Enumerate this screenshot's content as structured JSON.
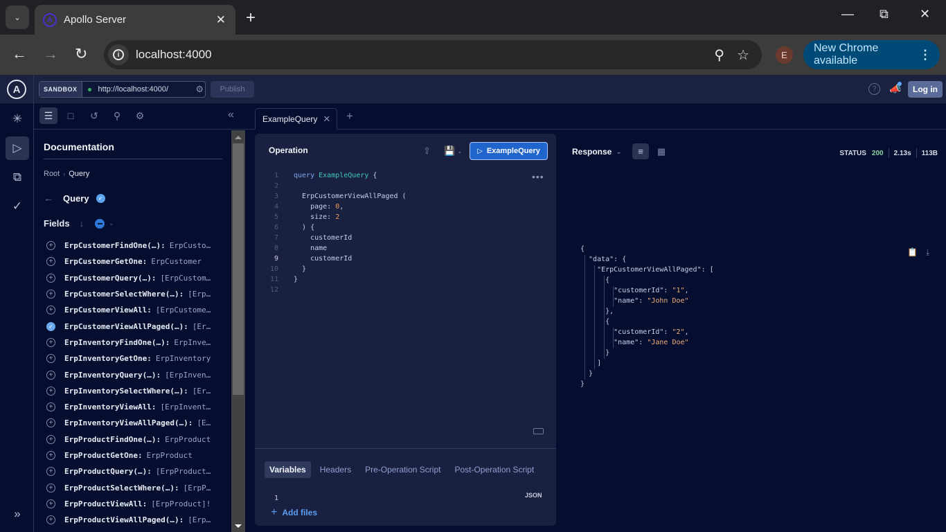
{
  "browser": {
    "tab_title": "Apollo Server",
    "url": "localhost:4000",
    "profile_initial": "E",
    "update_label": "New Chrome available"
  },
  "app": {
    "env_label": "SANDBOX",
    "endpoint": "http://localhost:4000/",
    "publish_label": "Publish",
    "login_label": "Log in"
  },
  "docs": {
    "title": "Documentation",
    "breadcrumb": [
      "Root",
      "Query"
    ],
    "current_type": "Query",
    "fields_label": "Fields",
    "fields": [
      {
        "name": "ErpCustomerFindOne(…):",
        "type": "ErpCusto…",
        "selected": false
      },
      {
        "name": "ErpCustomerGetOne:",
        "type": "ErpCustomer",
        "selected": false
      },
      {
        "name": "ErpCustomerQuery(…):",
        "type": "[ErpCustom…",
        "selected": false
      },
      {
        "name": "ErpCustomerSelectWhere(…):",
        "type": "[Erp…",
        "selected": false
      },
      {
        "name": "ErpCustomerViewAll:",
        "type": "[ErpCustome…",
        "selected": false
      },
      {
        "name": "ErpCustomerViewAllPaged(…):",
        "type": "[Er…",
        "selected": true
      },
      {
        "name": "ErpInventoryFindOne(…):",
        "type": "ErpInve…",
        "selected": false
      },
      {
        "name": "ErpInventoryGetOne:",
        "type": "ErpInventory",
        "selected": false
      },
      {
        "name": "ErpInventoryQuery(…):",
        "type": "[ErpInven…",
        "selected": false
      },
      {
        "name": "ErpInventorySelectWhere(…):",
        "type": "[Er…",
        "selected": false
      },
      {
        "name": "ErpInventoryViewAll:",
        "type": "[ErpInvent…",
        "selected": false
      },
      {
        "name": "ErpInventoryViewAllPaged(…):",
        "type": "[E…",
        "selected": false
      },
      {
        "name": "ErpProductFindOne(…):",
        "type": "ErpProduct",
        "selected": false
      },
      {
        "name": "ErpProductGetOne:",
        "type": "ErpProduct",
        "selected": false
      },
      {
        "name": "ErpProductQuery(…):",
        "type": "[ErpProduct…",
        "selected": false
      },
      {
        "name": "ErpProductSelectWhere(…):",
        "type": "[ErpP…",
        "selected": false
      },
      {
        "name": "ErpProductViewAll:",
        "type": "[ErpProduct]!",
        "selected": false
      },
      {
        "name": "ErpProductViewAllPaged(…):",
        "type": "[Erp…",
        "selected": false
      }
    ]
  },
  "operation": {
    "tab_label": "ExampleQuery",
    "panel_title": "Operation",
    "run_label": "ExampleQuery",
    "current_line": 9,
    "code_lines": [
      "query ExampleQuery {",
      "",
      "  ErpCustomerViewAllPaged (",
      "    page: 0,",
      "    size: 2",
      "  ) {",
      "    customerId",
      "    name",
      "    customerId",
      "  }",
      "}",
      ""
    ],
    "bottom_tabs": [
      "Variables",
      "Headers",
      "Pre-Operation Script",
      "Post-Operation Script"
    ],
    "active_bottom_tab": "Variables",
    "variables_line": "1",
    "format_label": "JSON",
    "add_files_label": "Add files"
  },
  "response": {
    "title": "Response",
    "status_label": "STATUS",
    "status_code": "200",
    "duration": "2.13s",
    "size": "113B",
    "json_lines": [
      "{",
      "  \"data\": {",
      "    \"ErpCustomerViewAllPaged\": [",
      "      {",
      "        \"customerId\": \"1\",",
      "        \"name\": \"John Doe\"",
      "      },",
      "      {",
      "        \"customerId\": \"2\",",
      "        \"name\": \"Jane Doe\"",
      "      }",
      "    ]",
      "  }",
      "}"
    ]
  },
  "colors": {
    "app_bg": "#050e2f",
    "run_button": "#2065cc",
    "status_ok": "#8fd2a6",
    "string_value": "#f0b07a",
    "operation_name": "#3fc9c0"
  }
}
